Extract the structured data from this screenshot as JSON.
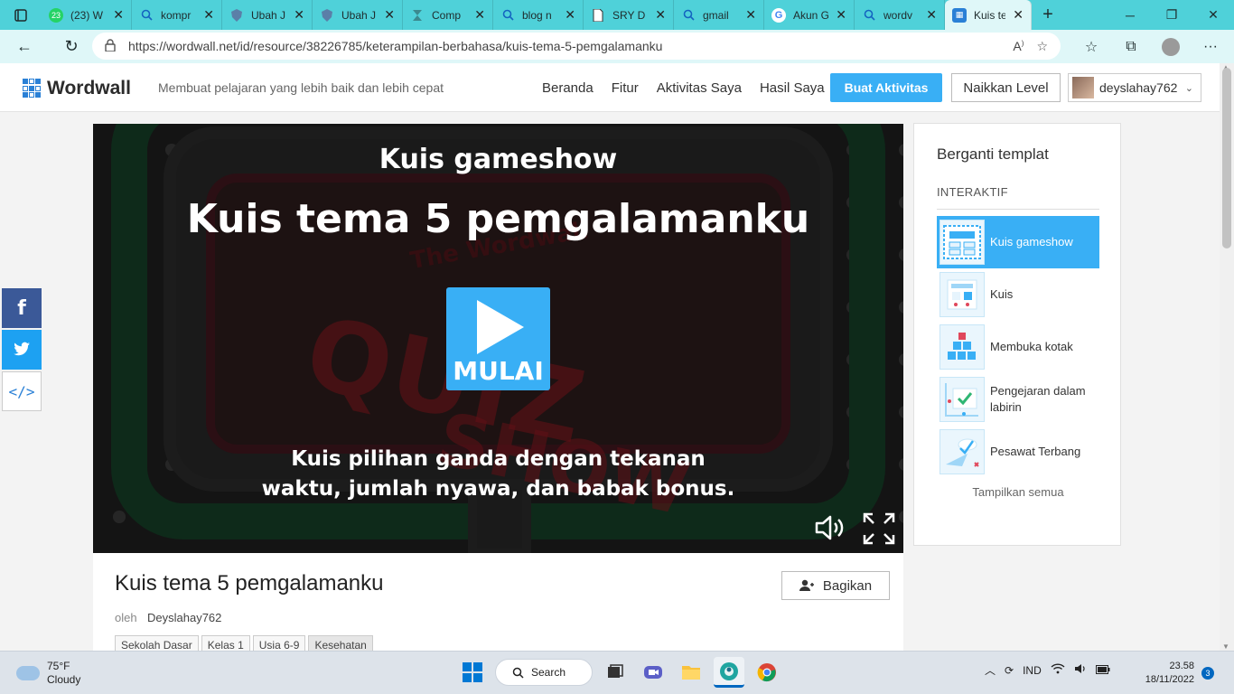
{
  "browser": {
    "tabs": [
      {
        "title": "(23) W",
        "icon": "whatsapp-icon",
        "badge": "23"
      },
      {
        "title": "kompr",
        "icon": "search-icon"
      },
      {
        "title": "Ubah J",
        "icon": "shield-icon"
      },
      {
        "title": "Ubah J",
        "icon": "shield-icon"
      },
      {
        "title": "Comp",
        "icon": "hourglass-icon"
      },
      {
        "title": "blog n",
        "icon": "search-icon"
      },
      {
        "title": "SRY D",
        "icon": "document-icon"
      },
      {
        "title": "gmail",
        "icon": "search-icon"
      },
      {
        "title": "Akun G",
        "icon": "google-icon"
      },
      {
        "title": "wordv",
        "icon": "search-icon"
      }
    ],
    "active_tab": {
      "title": "Kuis te",
      "icon": "wordwall-icon"
    },
    "url": "https://wordwall.net/id/resource/38226785/keterampilan-berbahasa/kuis-tema-5-pemgalamanku"
  },
  "header": {
    "brand": "Wordwall",
    "tagline": "Membuat pelajaran yang lebih baik dan lebih cepat",
    "nav": [
      "Beranda",
      "Fitur",
      "Aktivitas Saya",
      "Hasil Saya"
    ],
    "create_label": "Buat Aktivitas",
    "upgrade_label": "Naikkan Level",
    "username": "deyslahay762"
  },
  "game": {
    "type_label": "Kuis gameshow",
    "title": "Kuis tema 5 pemgalamanku",
    "start_label": "MULAI",
    "description_line1": "Kuis pilihan ganda dengan tekanan",
    "description_line2": "waktu, jumlah nyawa, dan babak bonus.",
    "watermark_small": "The Wordwall",
    "watermark_quiz": "QUIZ",
    "watermark_show": "SHOW"
  },
  "info": {
    "title": "Kuis tema 5 pemgalamanku",
    "by_label": "oleh",
    "author": "Deyslahay762",
    "share_label": "Bagikan",
    "tags": [
      "Sekolah Dasar",
      "Kelas 1",
      "Usia 6-9",
      "Kesehatan"
    ]
  },
  "templates": {
    "heading": "Berganti templat",
    "section": "INTERAKTIF",
    "items": [
      {
        "label": "Kuis gameshow",
        "selected": true
      },
      {
        "label": "Kuis",
        "selected": false
      },
      {
        "label": "Membuka kotak",
        "selected": false
      },
      {
        "label": "Pengejaran dalam labirin",
        "selected": false
      },
      {
        "label": "Pesawat Terbang",
        "selected": false
      }
    ],
    "show_all": "Tampilkan semua"
  },
  "taskbar": {
    "temperature": "75°F",
    "weather": "Cloudy",
    "search_label": "Search",
    "language": "IND",
    "time": "23.58",
    "date": "18/11/2022",
    "notifications": "3"
  },
  "colors": {
    "accent": "#39aff5",
    "browser_frame": "#4fd1d9",
    "facebook": "#3b5998",
    "twitter": "#1da1f2"
  }
}
